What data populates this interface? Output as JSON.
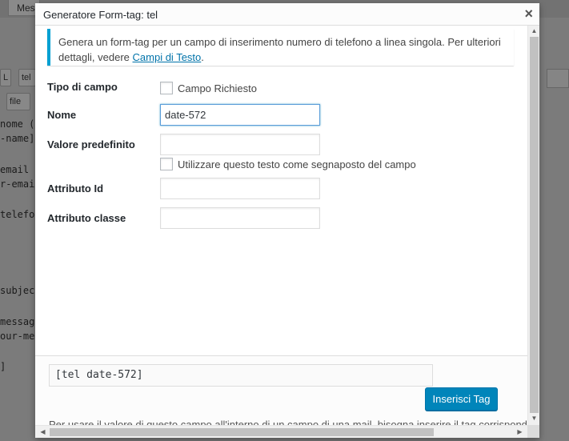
{
  "background": {
    "tab_label": "Mes",
    "toolbar_buttons": [
      {
        "label": "L"
      },
      {
        "label": "tel"
      },
      {
        "label": "file"
      }
    ],
    "code_lines": [
      {
        "text": "nome ("
      },
      {
        "text": "-name]"
      },
      {
        "text": "email"
      },
      {
        "text": "r-emai"
      },
      {
        "text": "telefo"
      },
      {
        "text": "subjec"
      },
      {
        "text": "messag"
      },
      {
        "text": "our-me"
      },
      {
        "text": "]"
      }
    ]
  },
  "dialog": {
    "title": "Generatore Form-tag: tel",
    "close_symbol": "×",
    "notice": {
      "text": "Genera un form-tag per un campo di inserimento numero di telefono a linea singola. Per ulteriori dettagli, vedere ",
      "link_text": "Campi di Testo",
      "suffix": "."
    },
    "fields": {
      "field_type_label": "Tipo di campo",
      "required_label": "Campo Richiesto",
      "name_label": "Nome",
      "name_value": "date-572",
      "default_label": "Valore predefinito",
      "default_value": "",
      "placeholder_label": "Utilizzare questo testo come segnaposto del campo",
      "id_label": "Attributo Id",
      "id_value": "",
      "class_label": "Attributo classe",
      "class_value": ""
    },
    "footer": {
      "tag_output": "[tel date-572]",
      "insert_button": "Inserisci Tag",
      "help_text": "Per usare il valore di questo campo all'interno di un campo di una mail, bisogna inserire il tag corrispondente nel campo"
    }
  }
}
